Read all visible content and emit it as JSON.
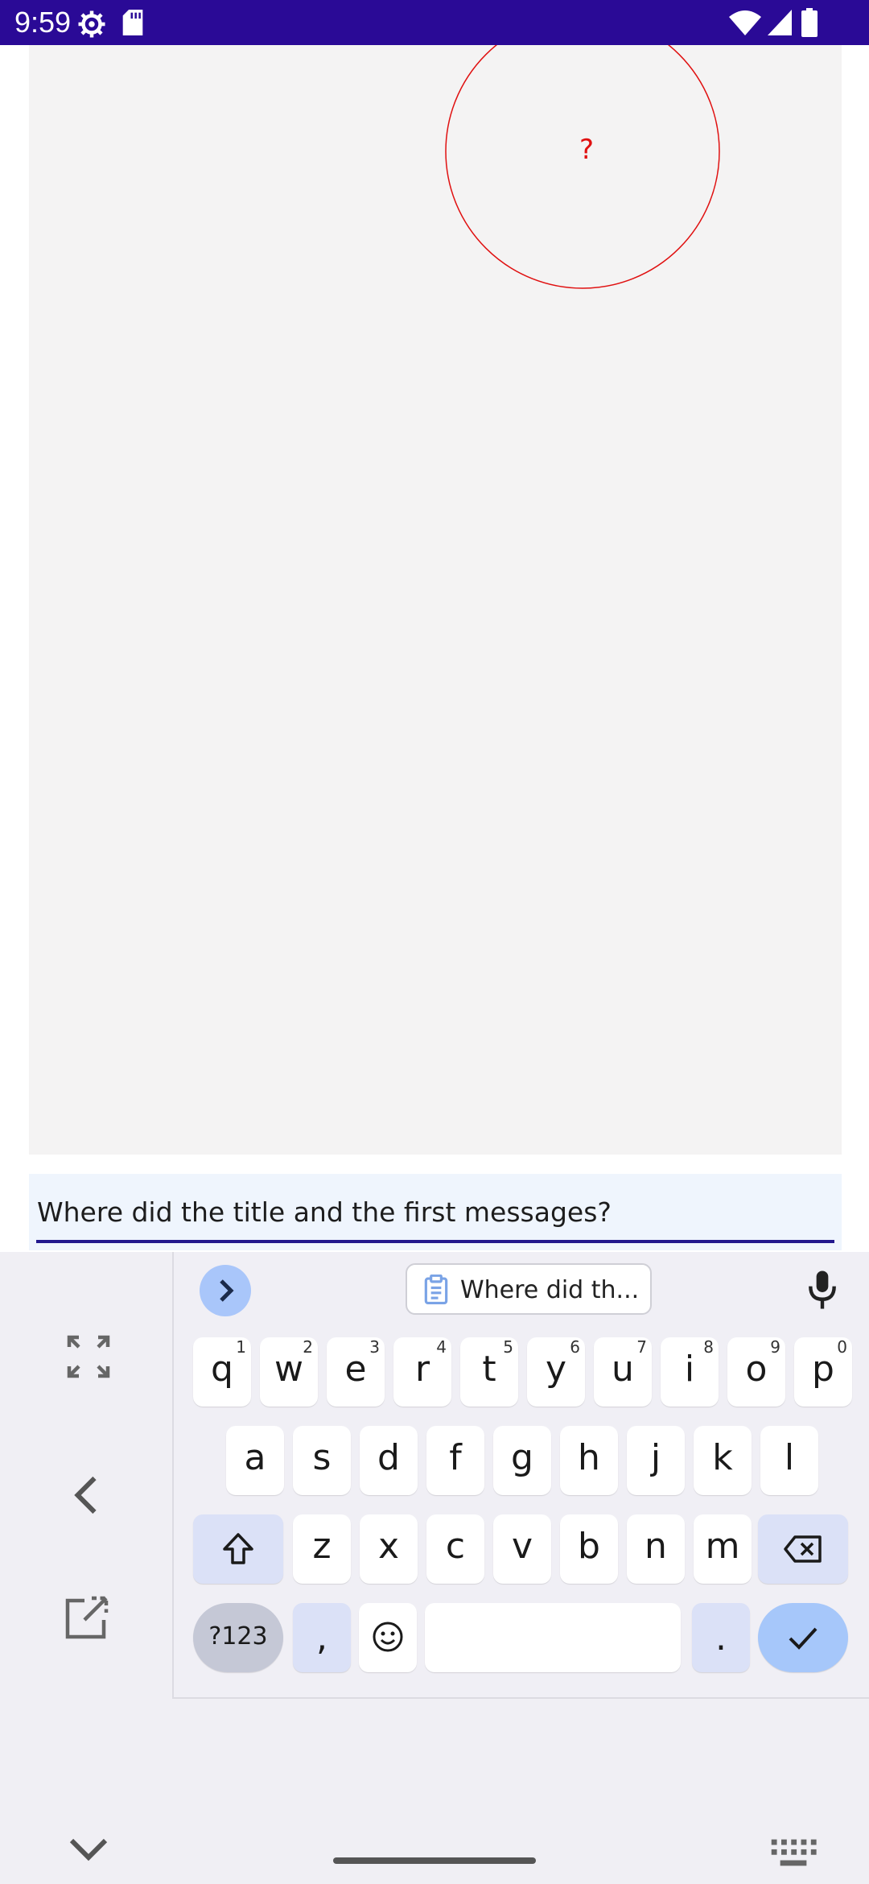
{
  "status_bar": {
    "time": "9:59",
    "left_icons": [
      "settings-gear-icon",
      "sd-card-icon"
    ],
    "right_icons": [
      "wifi-icon",
      "cell-signal-icon",
      "battery-icon"
    ],
    "background": "#2a0a96"
  },
  "canvas": {
    "marker_label": "?",
    "marker_color": "#e01010"
  },
  "text_input": {
    "value": "Where did the title and the first messages?"
  },
  "keyboard": {
    "suggestion_chip": "Where did th...",
    "rows": [
      [
        {
          "k": "q",
          "h": "1"
        },
        {
          "k": "w",
          "h": "2"
        },
        {
          "k": "e",
          "h": "3"
        },
        {
          "k": "r",
          "h": "4"
        },
        {
          "k": "t",
          "h": "5"
        },
        {
          "k": "y",
          "h": "6"
        },
        {
          "k": "u",
          "h": "7"
        },
        {
          "k": "i",
          "h": "8"
        },
        {
          "k": "o",
          "h": "9"
        },
        {
          "k": "p",
          "h": "0"
        }
      ],
      [
        {
          "k": "a"
        },
        {
          "k": "s"
        },
        {
          "k": "d"
        },
        {
          "k": "f"
        },
        {
          "k": "g"
        },
        {
          "k": "h"
        },
        {
          "k": "j"
        },
        {
          "k": "k"
        },
        {
          "k": "l"
        }
      ],
      [
        {
          "k": "z"
        },
        {
          "k": "x"
        },
        {
          "k": "c"
        },
        {
          "k": "v"
        },
        {
          "k": "b"
        },
        {
          "k": "n"
        },
        {
          "k": "m"
        }
      ]
    ],
    "symbols_key": "?123",
    "comma_key": ",",
    "period_key": ".",
    "accent_color": "#a6c7fa"
  }
}
